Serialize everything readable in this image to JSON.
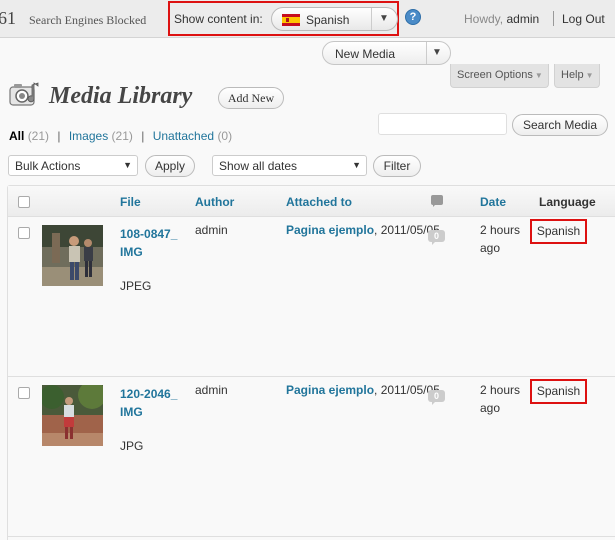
{
  "topbar": {
    "site_number": "61",
    "site_status": "Search Engines Blocked",
    "language_switcher": {
      "label": "Show content in:",
      "selected": "Spanish"
    },
    "howdy": "Howdy, ",
    "user": "admin",
    "logout": "Log Out",
    "help_glyph": "?"
  },
  "favorite_actions": {
    "label": "New Media"
  },
  "tabs": {
    "screen_options": "Screen Options",
    "help": "Help"
  },
  "page": {
    "title": "Media Library",
    "add_new": "Add New"
  },
  "filters": [
    {
      "label": "All",
      "count": "(21)",
      "current": true
    },
    {
      "label": "Images",
      "count": "(21)",
      "current": false
    },
    {
      "label": "Unattached",
      "count": "(0)",
      "current": false
    }
  ],
  "search": {
    "value": "",
    "button": "Search Media"
  },
  "tablenav": {
    "bulk_actions": "Bulk Actions",
    "apply": "Apply",
    "dates": "Show all dates",
    "filter": "Filter"
  },
  "table": {
    "columns": {
      "file": "File",
      "author": "Author",
      "attached_to": "Attached to",
      "date": "Date",
      "language": "Language"
    },
    "rows": [
      {
        "file": "108-0847_IMG",
        "type": "JPEG",
        "author": "admin",
        "attached_title": "Pagina ejemplo",
        "attached_date": ", 2011/05/05",
        "comments": "0",
        "date_line1": "2 hours",
        "date_line2": "ago",
        "language": "Spanish"
      },
      {
        "file": "120-2046_IMG",
        "type": "JPG",
        "author": "admin",
        "attached_title": "Pagina ejemplo",
        "attached_date": ", 2011/05/05",
        "comments": "0",
        "date_line1": "2 hours",
        "date_line2": "ago",
        "language": "Spanish"
      }
    ]
  },
  "icons": {
    "flag": "spain-flag-icon",
    "help": "help-icon",
    "page": "media-library-icon",
    "comments": "comment-icon",
    "dropdown": "chevron-down-icon"
  },
  "colors": {
    "link": "#21759b",
    "highlight_border": "#dd1111",
    "background": "#f9f9f9"
  }
}
